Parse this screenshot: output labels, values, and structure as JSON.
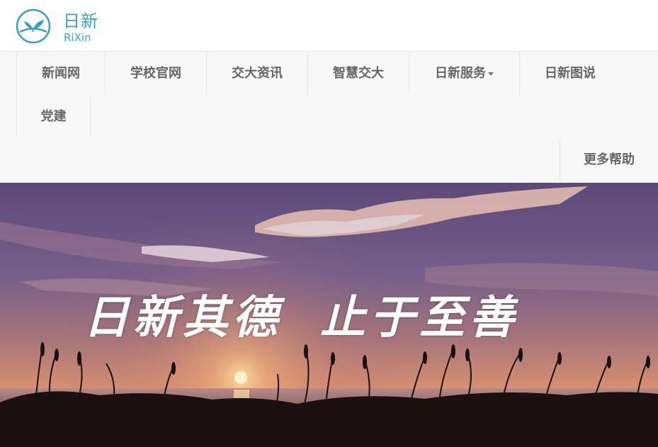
{
  "brand": {
    "name_cn": "日新",
    "name_en": "RiXin",
    "color": "#3aa1ba"
  },
  "nav": {
    "items": [
      {
        "label": "新闻网"
      },
      {
        "label": "学校官网"
      },
      {
        "label": "交大资讯"
      },
      {
        "label": "智慧交大"
      },
      {
        "label": "日新服务",
        "has_dropdown": true
      },
      {
        "label": "日新图说"
      },
      {
        "label": "党建"
      }
    ],
    "right_item": {
      "label": "更多帮助"
    }
  },
  "banner": {
    "slogan_left": "日新其德",
    "slogan_right": "止于至善"
  },
  "colors": {
    "nav_bg": "#f8f8f8",
    "nav_text": "#666666",
    "border": "#e6e6e6"
  }
}
